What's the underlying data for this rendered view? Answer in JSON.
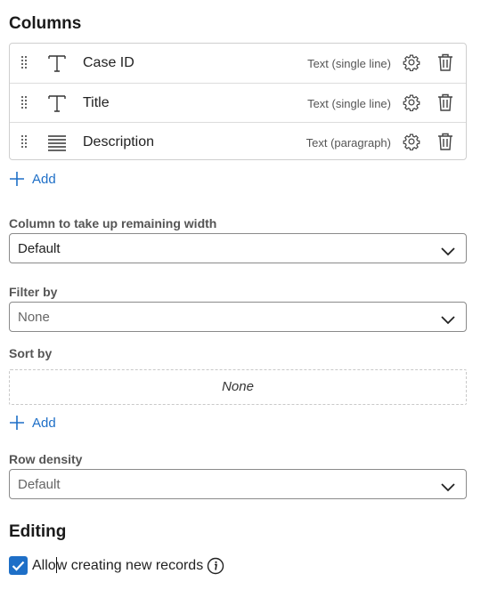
{
  "columns_section": {
    "title": "Columns",
    "items": [
      {
        "name": "Case ID",
        "type": "Text (single line)",
        "icon": "text-icon"
      },
      {
        "name": "Title",
        "type": "Text (single line)",
        "icon": "text-icon"
      },
      {
        "name": "Description",
        "type": "Text (paragraph)",
        "icon": "paragraph-icon"
      }
    ],
    "add_label": "Add"
  },
  "remaining_width": {
    "label": "Column to take up remaining width",
    "value": "Default"
  },
  "filter_by": {
    "label": "Filter by",
    "value": "None"
  },
  "sort_by": {
    "label": "Sort by",
    "empty_text": "None",
    "add_label": "Add"
  },
  "row_density": {
    "label": "Row density",
    "value": "Default"
  },
  "editing": {
    "title": "Editing",
    "allow_new_records": {
      "label_before_caret": "Allo",
      "label_after_caret": "w creating new records",
      "checked": true
    }
  },
  "colors": {
    "accent": "#1e6fc7",
    "select_text_active": "#1f1f1f",
    "select_text_placeholder": "#666666"
  }
}
